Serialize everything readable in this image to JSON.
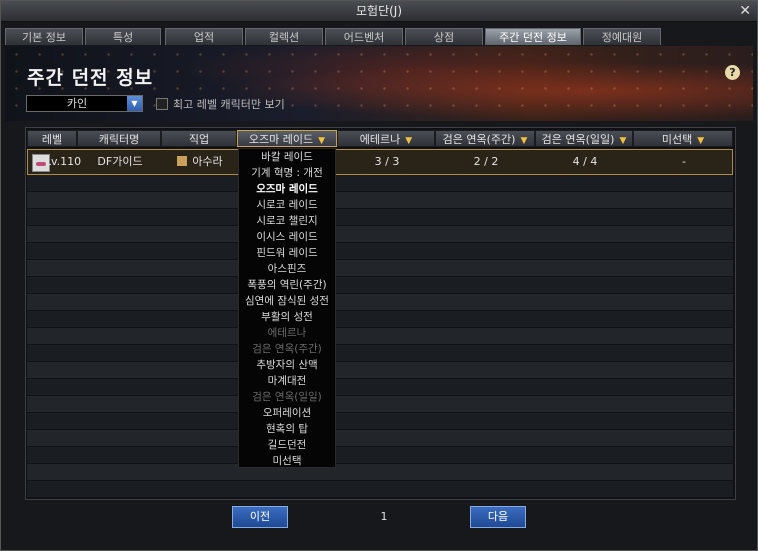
{
  "window": {
    "title": "모험단(J)"
  },
  "tabs": [
    {
      "label": "기본 정보",
      "active": false
    },
    {
      "label": "특성",
      "active": false
    },
    {
      "label": "업적",
      "active": false
    },
    {
      "label": "컬렉션",
      "active": false
    },
    {
      "label": "어드벤처",
      "active": false
    },
    {
      "label": "상점",
      "active": false
    },
    {
      "label": "주간 던전 정보",
      "active": true
    },
    {
      "label": "정예대원",
      "active": false
    }
  ],
  "page_title": "주간 던전 정보",
  "character_select": {
    "value": "카인"
  },
  "max_level_filter": {
    "label": "최고 레벨 캐릭터만 보기",
    "checked": false
  },
  "table": {
    "headers": [
      "레벨",
      "캐릭터명",
      "직업",
      "오즈마 레이드",
      "에테르나",
      "검은 연옥(주간)",
      "검은 연옥(일일)",
      "미선택"
    ],
    "rows": [
      {
        "level": "Lv.110",
        "name": "DF가이드",
        "job": "아수라",
        "col1": "",
        "col2": "3 / 3",
        "col3": "2 / 2",
        "col4": "4 / 4",
        "col5": "-"
      }
    ]
  },
  "dungeon_dropdown": {
    "selected": "오즈마 레이드",
    "items": [
      {
        "label": "바칼 레이드",
        "state": "normal"
      },
      {
        "label": "기계 혁명 : 개전",
        "state": "normal"
      },
      {
        "label": "오즈마 레이드",
        "state": "selected"
      },
      {
        "label": "시로코 레이드",
        "state": "normal"
      },
      {
        "label": "시로코 챌린지",
        "state": "normal"
      },
      {
        "label": "이시스 레이드",
        "state": "normal"
      },
      {
        "label": "핀드워 레이드",
        "state": "normal"
      },
      {
        "label": "아스핀즈",
        "state": "normal"
      },
      {
        "label": "폭풍의 역린(주간)",
        "state": "normal"
      },
      {
        "label": "심연에 잠식된 성전",
        "state": "normal"
      },
      {
        "label": "부활의 성전",
        "state": "normal"
      },
      {
        "label": "에테르나",
        "state": "disabled"
      },
      {
        "label": "검은 연옥(주간)",
        "state": "disabled"
      },
      {
        "label": "추방자의 산맥",
        "state": "normal"
      },
      {
        "label": "마계대전",
        "state": "normal"
      },
      {
        "label": "검은 연옥(일일)",
        "state": "disabled"
      },
      {
        "label": "오퍼레이션",
        "state": "normal"
      },
      {
        "label": "현혹의 탑",
        "state": "normal"
      },
      {
        "label": "길드던전",
        "state": "normal"
      },
      {
        "label": "미선택",
        "state": "normal"
      }
    ]
  },
  "pagination": {
    "prev_label": "이전",
    "page": "1",
    "next_label": "다음"
  },
  "colors": {
    "accent_blue": "#2f5fae",
    "header_gold": "#c9a24a",
    "arrow_yellow": "#f0c040"
  }
}
